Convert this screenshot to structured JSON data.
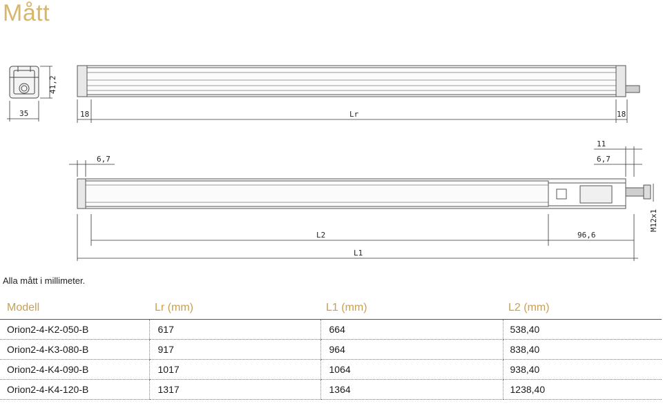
{
  "page": {
    "title": "Mått",
    "note": "Alla mått i millimeter."
  },
  "drawing": {
    "dim_height": "41,2",
    "dim_width": "35",
    "dim_end_left": "18",
    "dim_lr": "Lr",
    "dim_end_right": "18",
    "dim_left_offset": "6,7",
    "dim_right_top": "11",
    "dim_right_offset": "6,7",
    "dim_l2": "L2",
    "dim_96": "96,6",
    "dim_l1": "L1",
    "dim_m12": "M12x1"
  },
  "table": {
    "headers": [
      "Modell",
      "Lr (mm)",
      "L1 (mm)",
      "L2 (mm)"
    ],
    "rows": [
      [
        "Orion2-4-K2-050-B",
        "617",
        "664",
        "538,40"
      ],
      [
        "Orion2-4-K3-080-B",
        "917",
        "964",
        "838,40"
      ],
      [
        "Orion2-4-K4-090-B",
        "1017",
        "1064",
        "938,40"
      ],
      [
        "Orion2-4-K4-120-B",
        "1317",
        "1364",
        "1238,40"
      ]
    ]
  }
}
